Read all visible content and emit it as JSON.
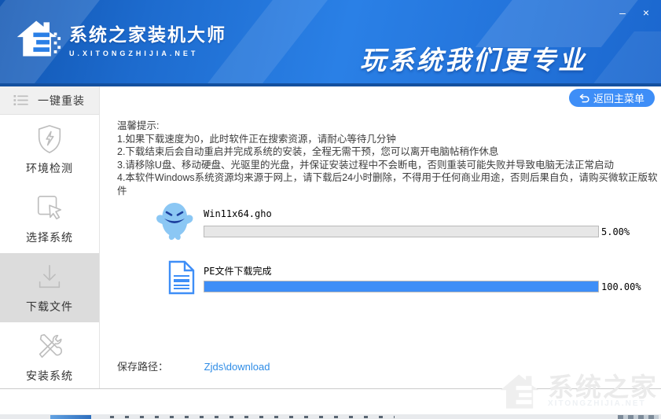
{
  "window": {
    "minimize_glyph": "–",
    "close_glyph": "×"
  },
  "header": {
    "brand_title": "系统之家装机大师",
    "brand_subtitle": "U.XITONGZHIJIA.NET",
    "slogan": "玩系统我们更专业"
  },
  "sidebar": {
    "items": [
      {
        "label": "一键重装",
        "icon": "list-icon",
        "active": false
      },
      {
        "label": "环境检测",
        "icon": "shield-check-icon",
        "active": false
      },
      {
        "label": "选择系统",
        "icon": "select-cursor-icon",
        "active": false
      },
      {
        "label": "下载文件",
        "icon": "download-icon",
        "active": true
      },
      {
        "label": "安装系统",
        "icon": "tools-icon",
        "active": false
      }
    ]
  },
  "main": {
    "back_button": {
      "label": "返回主菜单",
      "icon": "return-arrow-icon"
    },
    "tips": {
      "title": "温馨提示:",
      "lines": [
        "1.如果下载速度为0，此时软件正在搜索资源，请耐心等待几分钟",
        "2.下载结束后会自动重启并完成系统的安装，全程无需干预，您可以离开电脑帖稍作休息",
        "3.请移除U盘、移动硬盘、光驱里的光盘，并保证安装过程中不会断电，否则重装可能失败并导致电脑无法正常启动",
        "4.本软件Windows系统资源均来源于网上，请下载后24小时删除，不得用于任何商业用途，否则后果自负，请购买微软正版软件"
      ]
    },
    "downloads": [
      {
        "name": "Win11x64.gho",
        "percent": "5.00%",
        "progress": 5,
        "bar_color": "#e7e7e7",
        "icon": "ghost-mascot-icon"
      },
      {
        "name": "PE文件下载完成",
        "percent": "100.00%",
        "progress": 100,
        "bar_color": "#3e8ef7",
        "icon": "document-icon"
      }
    ],
    "save_path": {
      "label": "保存路径：",
      "value": "Zjds\\download"
    }
  },
  "watermark": {
    "title": "系统之家",
    "subtitle": "XITONGZHIJIA.NET"
  },
  "colors": {
    "accent_blue": "#3e8ef7",
    "link_blue": "#2e8ce6",
    "header_blue": "#2373da",
    "header_band": "#14509f",
    "sidebar_active_bg": "#dcdcdc",
    "progress_track": "#e7e7e7"
  }
}
